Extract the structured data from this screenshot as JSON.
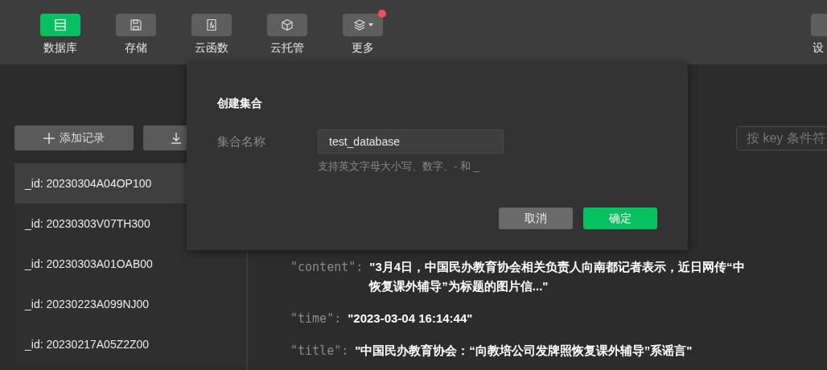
{
  "toolbar": {
    "items": [
      {
        "label": "数据库",
        "selected": true,
        "badge": false,
        "dropdown": false
      },
      {
        "label": "存储",
        "selected": false,
        "badge": false,
        "dropdown": false
      },
      {
        "label": "云函数",
        "selected": false,
        "badge": false,
        "dropdown": false
      },
      {
        "label": "云托管",
        "selected": false,
        "badge": false,
        "dropdown": false
      },
      {
        "label": "更多",
        "selected": false,
        "badge": true,
        "dropdown": true
      }
    ],
    "right_item": {
      "label": "设"
    }
  },
  "records_panel": {
    "add_button": "添加记录",
    "records": [
      {
        "label": "_id: 20230304A04OP100",
        "selected": true
      },
      {
        "label": "_id: 20230303V07TH300",
        "selected": false
      },
      {
        "label": "_id: 20230303A01OAB00",
        "selected": false
      },
      {
        "label": "_id: 20230223A099NJ00",
        "selected": false
      },
      {
        "label": "_id: 20230217A05Z2Z00",
        "selected": false
      }
    ]
  },
  "filter": {
    "placeholder": "按 key 条件符"
  },
  "document": {
    "fields": [
      {
        "key": "\"content\":",
        "lines": [
          "\"3月4日，中国民办教育协会相关负责人向南都记者表示，近日网传“中",
          "恢复课外辅导”为标题的图片信...\""
        ]
      },
      {
        "key": "\"time\":",
        "lines": [
          "\"2023-03-04 16:14:44\""
        ]
      },
      {
        "key": "\"title\":",
        "lines": [
          "\"中国民办教育协会：“向教培公司发牌照恢复课外辅导”系谣言\""
        ]
      }
    ]
  },
  "dialog": {
    "title": "创建集合",
    "field_label": "集合名称",
    "field_value": "test_database",
    "hint": "支持英文字母大小写、数字、- 和 _",
    "cancel": "取消",
    "confirm": "确定"
  }
}
